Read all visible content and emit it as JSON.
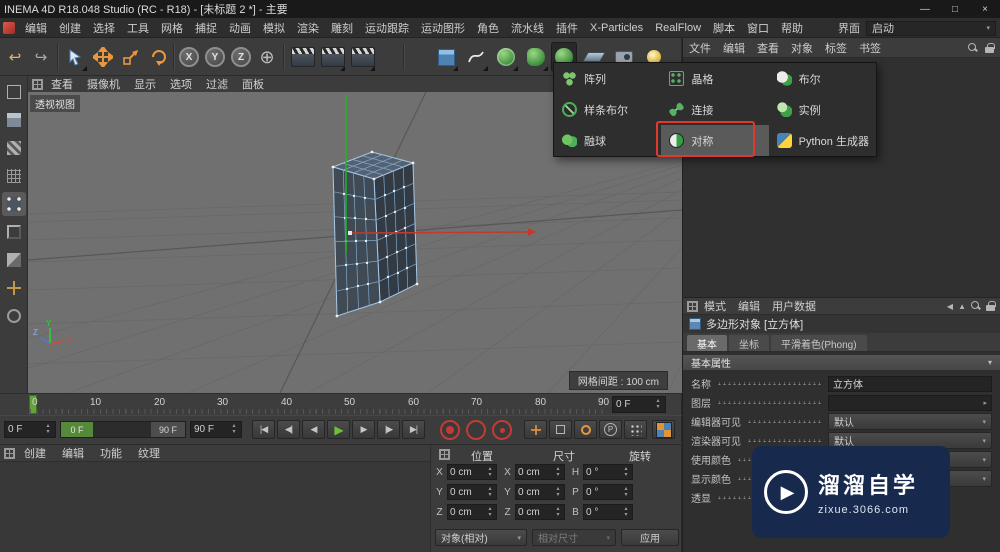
{
  "window": {
    "title": "INEMA 4D R18.048 Studio (RC - R18) - [未标题 2 *] - 主要",
    "minimize": "—",
    "maximize": "□",
    "close": "×"
  },
  "menu_bar": {
    "items": [
      "编辑",
      "创建",
      "选择",
      "工具",
      "网格",
      "捕捉",
      "动画",
      "模拟",
      "渲染",
      "雕刻",
      "运动跟踪",
      "运动图形",
      "角色",
      "流水线",
      "插件",
      "X-Particles",
      "RealFlow",
      "脚本",
      "窗口",
      "帮助"
    ],
    "interface_label": "界面",
    "layout_value": "启动"
  },
  "toolbar": {
    "x": "X",
    "y": "Y",
    "z": "Z"
  },
  "object_manager": {
    "menu": [
      "文件",
      "编辑",
      "查看",
      "对象",
      "标签",
      "书签"
    ]
  },
  "generator_menu": {
    "items": [
      {
        "label": "阵列"
      },
      {
        "label": "晶格"
      },
      {
        "label": "布尔"
      },
      {
        "label": "样条布尔"
      },
      {
        "label": "连接"
      },
      {
        "label": "实例"
      },
      {
        "label": "融球"
      },
      {
        "label": "对称"
      },
      {
        "label": "Python 生成器"
      }
    ],
    "highlighted_item": "对称"
  },
  "viewport": {
    "menu": [
      "查看",
      "摄像机",
      "显示",
      "选项",
      "过滤",
      "面板"
    ],
    "view_label": "透视视图",
    "grid_spacing": "网格间距 : 100 cm",
    "axis_y": "Y",
    "axis_x": "X",
    "axis_z": "Z"
  },
  "timeline": {
    "ticks": [
      "0",
      "10",
      "20",
      "30",
      "40",
      "50",
      "60",
      "70",
      "80",
      "90"
    ],
    "frame_field": "0 F"
  },
  "transport": {
    "start_field": "0 F",
    "range_start": "0 F",
    "range_end": "90 F",
    "end_field": "90 F",
    "go_start": "|◀",
    "prev_key": "◀|",
    "prev_frame": "◀",
    "play": "▶",
    "next_frame": "▶",
    "next_key": "|▶",
    "go_end": "▶|",
    "parameter": "P"
  },
  "materials_panel": {
    "menu": [
      "创建",
      "编辑",
      "功能",
      "纹理"
    ]
  },
  "coordinates": {
    "headers": [
      "位置",
      "尺寸",
      "旋转"
    ],
    "position": {
      "x_label": "X",
      "x": "0 cm",
      "y_label": "Y",
      "y": "0 cm",
      "z_label": "Z",
      "z": "0 cm"
    },
    "size": {
      "x_label": "X",
      "x": "0 cm",
      "y_label": "Y",
      "y": "0 cm",
      "z_label": "Z",
      "z": "0 cm"
    },
    "rotation": {
      "h_label": "H",
      "h": "0 °",
      "p_label": "P",
      "p": "0 °",
      "b_label": "B",
      "b": "0 °"
    },
    "mode": "对象(相对)",
    "size_mode": "相对尺寸",
    "apply": "应用"
  },
  "attributes": {
    "menu": [
      "模式",
      "编辑",
      "用户数据"
    ],
    "object_title": "多边形对象 [立方体]",
    "tabs": [
      "基本",
      "坐标",
      "平滑着色(Phong)"
    ],
    "section": "基本属性",
    "rows": [
      {
        "label": "名称",
        "value": "立方体"
      },
      {
        "label": "图层",
        "value": ""
      },
      {
        "label": "编辑器可见",
        "value": "默认"
      },
      {
        "label": "渲染器可见",
        "value": "默认"
      },
      {
        "label": "使用颜色",
        "value": ""
      },
      {
        "label": "显示颜色",
        "value": ""
      },
      {
        "label": "透显",
        "value": ""
      }
    ]
  },
  "watermark": {
    "brand": "溜溜自学",
    "url": "zixue.3066.com"
  },
  "colors": {
    "annotation_red": "#e03a2f",
    "axis_green": "#1fb41f",
    "axis_red": "#c23a2e",
    "play_green": "#6fbe3a",
    "watermark_bg": "#17294d"
  }
}
